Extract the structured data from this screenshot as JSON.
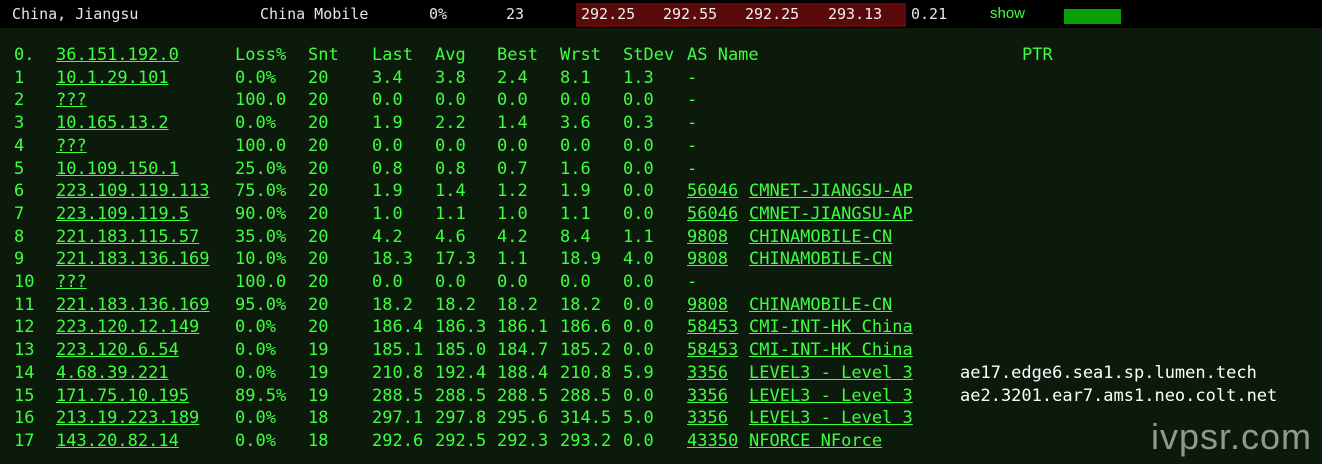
{
  "summary": {
    "location": "China, Jiangsu",
    "isp": "China Mobile",
    "loss": "0%",
    "sent": "23",
    "latencies": [
      "292.25",
      "292.55",
      "292.25",
      "293.13"
    ],
    "stdev": "0.21",
    "show_label": "show",
    "colors": {
      "latency_bg": "#5a0a0a",
      "bar": "#07a007",
      "text_green": "#3eff3e"
    }
  },
  "header": {
    "idx": "0.",
    "host": "36.151.192.0",
    "loss": "Loss%",
    "snt": "Snt",
    "last": "Last",
    "avg": "Avg",
    "best": "Best",
    "wrst": "Wrst",
    "stdev": "StDev",
    "as_name": "AS Name",
    "ptr": "PTR"
  },
  "hops": [
    {
      "idx": "1",
      "host": "10.1.29.101",
      "loss": "0.0%",
      "snt": "20",
      "last": "3.4",
      "avg": "3.8",
      "best": "2.4",
      "wrst": "8.1",
      "stdev": "1.3",
      "asn": "-",
      "asname": "",
      "ptr": ""
    },
    {
      "idx": "2",
      "host": "???",
      "loss": "100.0",
      "snt": "20",
      "last": "0.0",
      "avg": "0.0",
      "best": "0.0",
      "wrst": "0.0",
      "stdev": "0.0",
      "asn": "-",
      "asname": "",
      "ptr": ""
    },
    {
      "idx": "3",
      "host": "10.165.13.2",
      "loss": "0.0%",
      "snt": "20",
      "last": "1.9",
      "avg": "2.2",
      "best": "1.4",
      "wrst": "3.6",
      "stdev": "0.3",
      "asn": "-",
      "asname": "",
      "ptr": ""
    },
    {
      "idx": "4",
      "host": "???",
      "loss": "100.0",
      "snt": "20",
      "last": "0.0",
      "avg": "0.0",
      "best": "0.0",
      "wrst": "0.0",
      "stdev": "0.0",
      "asn": "-",
      "asname": "",
      "ptr": ""
    },
    {
      "idx": "5",
      "host": "10.109.150.1",
      "loss": "25.0%",
      "snt": "20",
      "last": "0.8",
      "avg": "0.8",
      "best": "0.7",
      "wrst": "1.6",
      "stdev": "0.0",
      "asn": "-",
      "asname": "",
      "ptr": ""
    },
    {
      "idx": "6",
      "host": "223.109.119.113",
      "loss": "75.0%",
      "snt": "20",
      "last": "1.9",
      "avg": "1.4",
      "best": "1.2",
      "wrst": "1.9",
      "stdev": "0.0",
      "asn": "56046",
      "asname": "CMNET-JIANGSU-AP",
      "ptr": ""
    },
    {
      "idx": "7",
      "host": "223.109.119.5",
      "loss": "90.0%",
      "snt": "20",
      "last": "1.0",
      "avg": "1.1",
      "best": "1.0",
      "wrst": "1.1",
      "stdev": "0.0",
      "asn": "56046",
      "asname": "CMNET-JIANGSU-AP",
      "ptr": ""
    },
    {
      "idx": "8",
      "host": "221.183.115.57",
      "loss": "35.0%",
      "snt": "20",
      "last": "4.2",
      "avg": "4.6",
      "best": "4.2",
      "wrst": "8.4",
      "stdev": "1.1",
      "asn": "9808",
      "asname": "CHINAMOBILE-CN",
      "ptr": ""
    },
    {
      "idx": "9",
      "host": "221.183.136.169",
      "loss": "10.0%",
      "snt": "20",
      "last": "18.3",
      "avg": "17.3",
      "best": "1.1",
      "wrst": "18.9",
      "stdev": "4.0",
      "asn": "9808",
      "asname": "CHINAMOBILE-CN",
      "ptr": ""
    },
    {
      "idx": "10",
      "host": "???",
      "loss": "100.0",
      "snt": "20",
      "last": "0.0",
      "avg": "0.0",
      "best": "0.0",
      "wrst": "0.0",
      "stdev": "0.0",
      "asn": "-",
      "asname": "",
      "ptr": ""
    },
    {
      "idx": "11",
      "host": "221.183.136.169",
      "loss": "95.0%",
      "snt": "20",
      "last": "18.2",
      "avg": "18.2",
      "best": "18.2",
      "wrst": "18.2",
      "stdev": "0.0",
      "asn": "9808",
      "asname": "CHINAMOBILE-CN",
      "ptr": ""
    },
    {
      "idx": "12",
      "host": "223.120.12.149",
      "loss": "0.0%",
      "snt": "20",
      "last": "186.4",
      "avg": "186.3",
      "best": "186.1",
      "wrst": "186.6",
      "stdev": "0.0",
      "asn": "58453",
      "asname": "CMI-INT-HK China",
      "ptr": ""
    },
    {
      "idx": "13",
      "host": "223.120.6.54",
      "loss": "0.0%",
      "snt": "19",
      "last": "185.1",
      "avg": "185.0",
      "best": "184.7",
      "wrst": "185.2",
      "stdev": "0.0",
      "asn": "58453",
      "asname": "CMI-INT-HK China",
      "ptr": ""
    },
    {
      "idx": "14",
      "host": "4.68.39.221",
      "loss": "0.0%",
      "snt": "19",
      "last": "210.8",
      "avg": "192.4",
      "best": "188.4",
      "wrst": "210.8",
      "stdev": "5.9",
      "asn": "3356",
      "asname": "LEVEL3 - Level 3",
      "ptr": "ae17.edge6.sea1.sp.lumen.tech"
    },
    {
      "idx": "15",
      "host": "171.75.10.195",
      "loss": "89.5%",
      "snt": "19",
      "last": "288.5",
      "avg": "288.5",
      "best": "288.5",
      "wrst": "288.5",
      "stdev": "0.0",
      "asn": "3356",
      "asname": "LEVEL3 - Level 3",
      "ptr": "ae2.3201.ear7.ams1.neo.colt.net"
    },
    {
      "idx": "16",
      "host": "213.19.223.189",
      "loss": "0.0%",
      "snt": "18",
      "last": "297.1",
      "avg": "297.8",
      "best": "295.6",
      "wrst": "314.5",
      "stdev": "5.0",
      "asn": "3356",
      "asname": "LEVEL3 - Level 3",
      "ptr": ""
    },
    {
      "idx": "17",
      "host": "143.20.82.14",
      "loss": "0.0%",
      "snt": "18",
      "last": "292.6",
      "avg": "292.5",
      "best": "292.3",
      "wrst": "293.2",
      "stdev": "0.0",
      "asn": "43350",
      "asname": "NFORCE NForce",
      "ptr": ""
    }
  ],
  "watermark": "ivpsr.com"
}
